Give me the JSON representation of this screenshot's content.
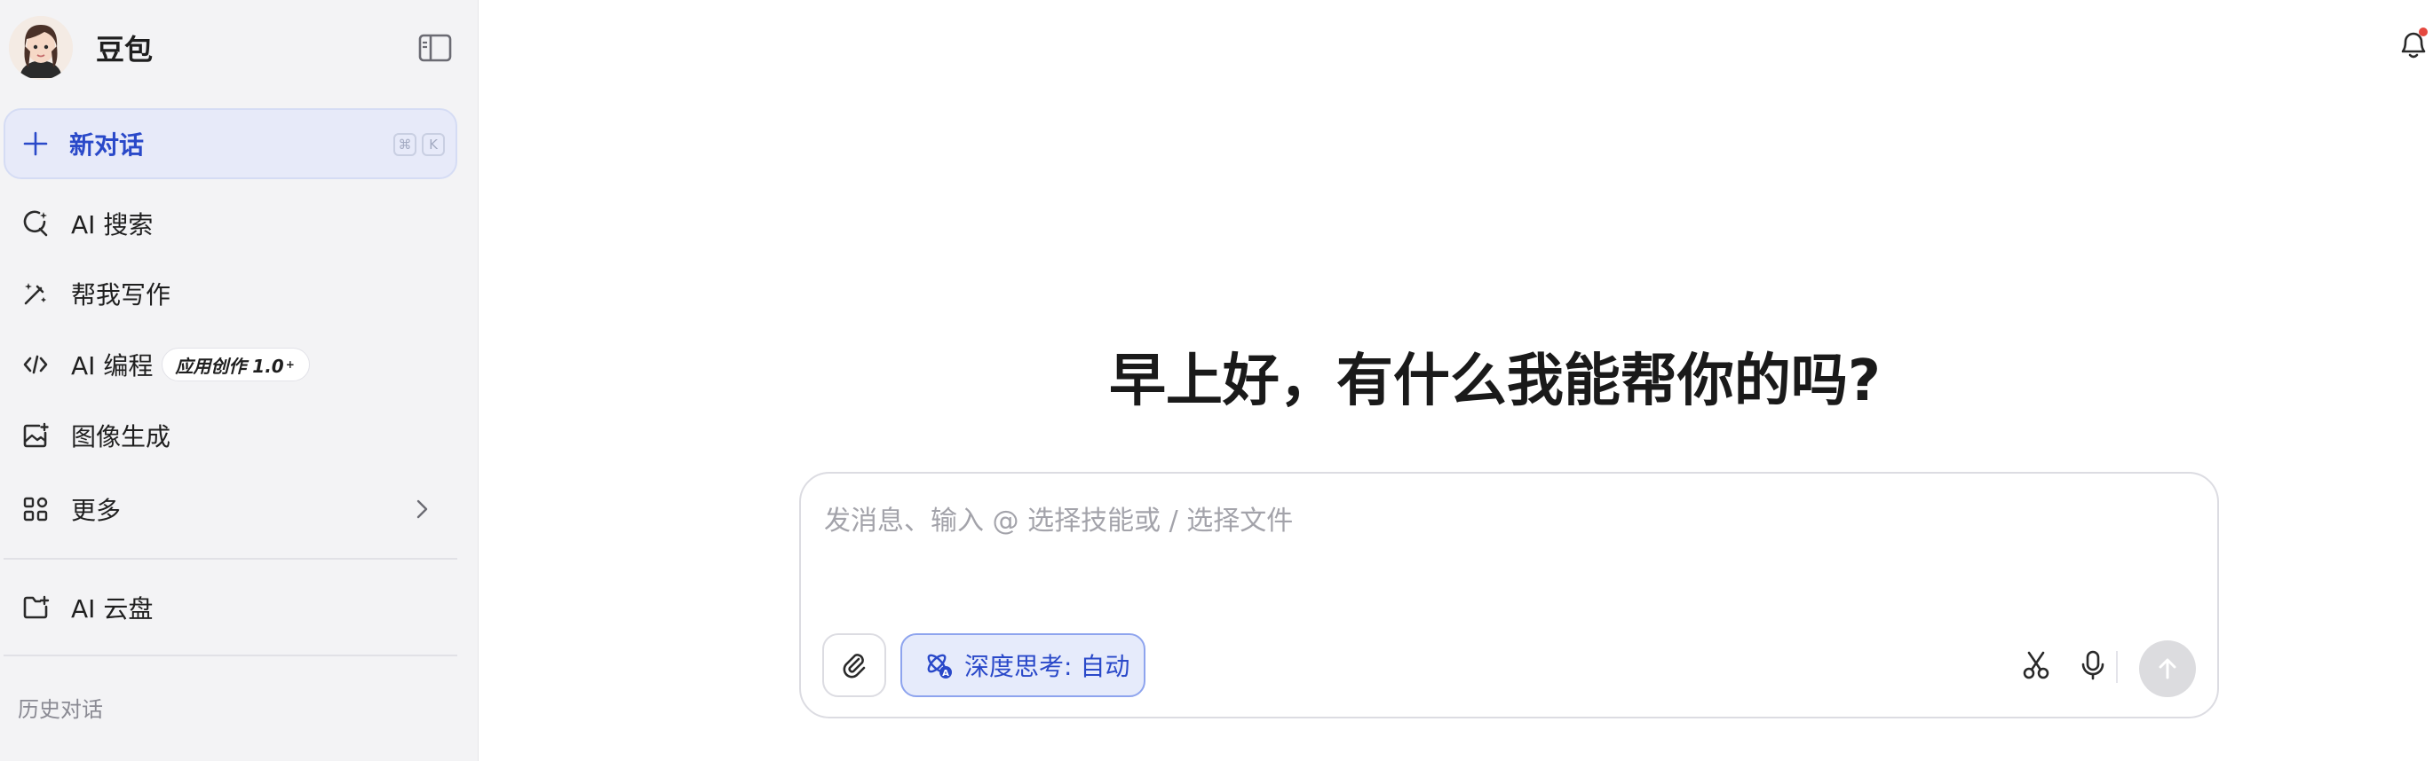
{
  "brand": {
    "name": "豆包"
  },
  "sidebar": {
    "new_chat": {
      "label": "新对话",
      "shortcut_keys": [
        "⌘",
        "K"
      ]
    },
    "items": [
      {
        "label": "AI 搜索",
        "icon": "search-sparkle-icon"
      },
      {
        "label": "帮我写作",
        "icon": "magic-pen-icon"
      },
      {
        "label": "AI 编程",
        "icon": "code-icon",
        "badge": "应用创作 1.0",
        "badge_mark": "+"
      },
      {
        "label": "图像生成",
        "icon": "image-plus-icon"
      },
      {
        "label": "更多",
        "icon": "apps-grid-icon"
      },
      {
        "label": "AI 云盘",
        "icon": "folder-plus-icon"
      }
    ],
    "history_title": "历史对话"
  },
  "main": {
    "greeting": "早上好，有什么我能帮你的吗?",
    "composer": {
      "placeholder": "发消息、输入 @ 选择技能或 / 选择文件",
      "value": "",
      "deep_think_label": "深度思考: 自动"
    }
  },
  "colors": {
    "accent": "#2a49c9",
    "sidebar_bg": "#f3f3f5",
    "new_chat_bg": "#e7eaf9",
    "notification_dot": "#e5483f",
    "send_disabled": "#dcdcdf"
  }
}
